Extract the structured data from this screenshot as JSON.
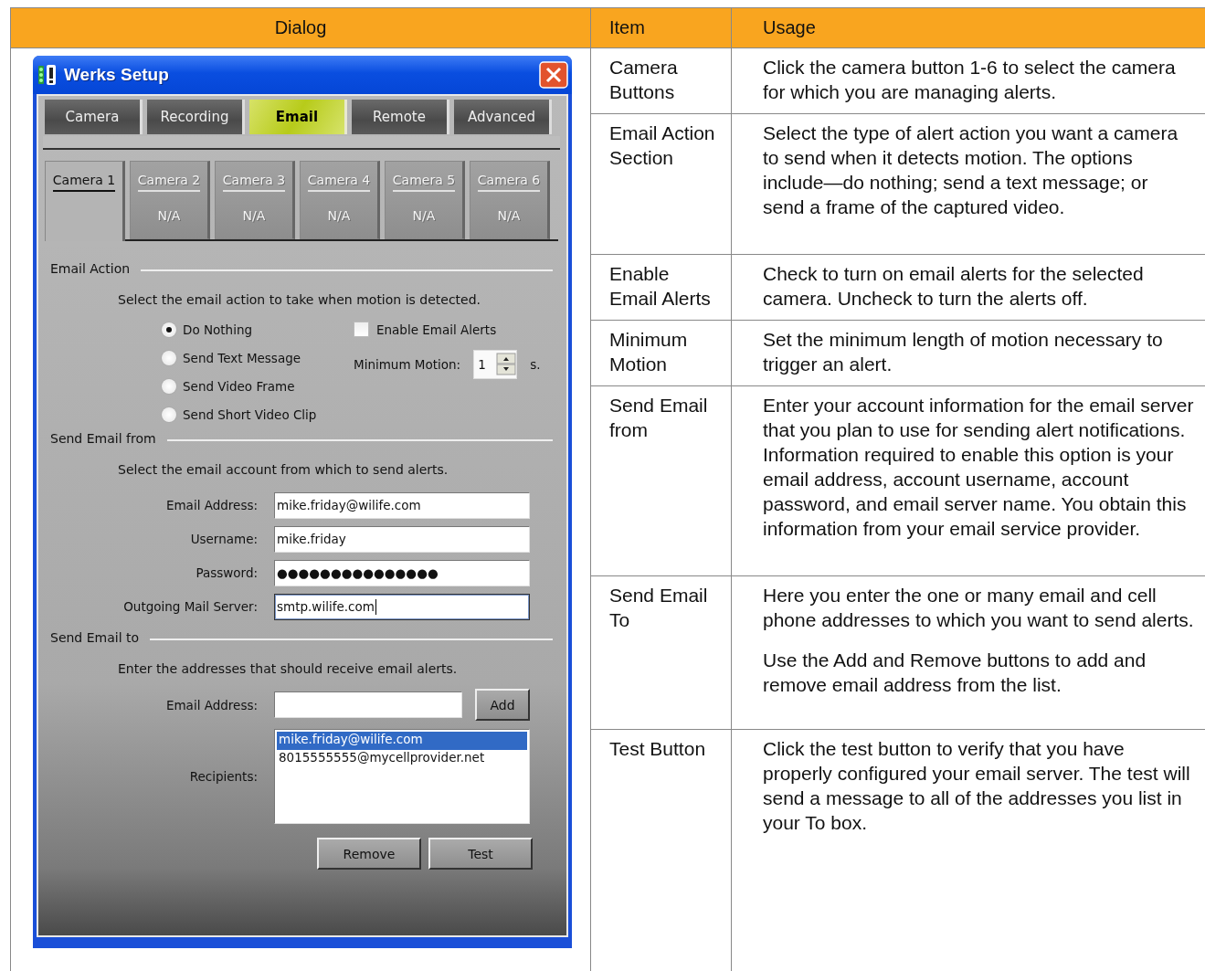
{
  "table": {
    "columns": [
      "Dialog",
      "Item",
      "Usage"
    ],
    "rows": [
      {
        "item": "Camera Buttons",
        "usage": [
          "Click the camera button 1-6 to select the camera for which you are managing alerts."
        ]
      },
      {
        "item": "Email Action Section",
        "usage": [
          "Select the type of alert action you want a camera to send when it detects motion. The options include—do nothing; send a text message; or send a frame of the captured video."
        ]
      },
      {
        "item": "Enable Email Alerts",
        "usage": [
          "Check to turn on email alerts for the selected camera. Uncheck to turn the alerts off."
        ]
      },
      {
        "item": "Minimum Motion",
        "usage": [
          "Set the minimum length of motion necessary to trigger an alert."
        ]
      },
      {
        "item": "Send Email from",
        "usage": [
          "Enter your account information for the email server that you plan to use for sending alert notifications. Information required to enable this option is your email address, account username, account password, and email server name. You obtain this information from your email service provider."
        ]
      },
      {
        "item": "Send Email To",
        "usage": [
          "Here you enter the one or many email and cell phone addresses to which you want to send alerts.",
          "Use the Add and Remove buttons to add and remove email address from the list."
        ]
      },
      {
        "item": "Test Button",
        "usage": [
          "Click the test button to verify that you have properly configured your email server. The test will send a message to all of the addresses you list in your To box."
        ]
      }
    ]
  },
  "dialog": {
    "title": "Werks Setup",
    "tabs": [
      {
        "label": "Camera",
        "selected": false
      },
      {
        "label": "Recording",
        "selected": false
      },
      {
        "label": "Email",
        "selected": true
      },
      {
        "label": "Remote",
        "selected": false
      },
      {
        "label": "Advanced",
        "selected": false
      }
    ],
    "camera_tabs": [
      {
        "label": "Camera 1",
        "selected": true,
        "disabled": false
      },
      {
        "label": "Camera 2",
        "status": "N/A",
        "selected": false,
        "disabled": true
      },
      {
        "label": "Camera 3",
        "status": "N/A",
        "selected": false,
        "disabled": true
      },
      {
        "label": "Camera 4",
        "status": "N/A",
        "selected": false,
        "disabled": true
      },
      {
        "label": "Camera 5",
        "status": "N/A",
        "selected": false,
        "disabled": true
      },
      {
        "label": "Camera 6",
        "status": "N/A",
        "selected": false,
        "disabled": true
      }
    ],
    "email_action": {
      "heading": "Email Action",
      "instruction": "Select the email action to take when motion is detected.",
      "options": [
        {
          "label": "Do Nothing",
          "selected": true
        },
        {
          "label": "Send Text Message",
          "selected": false
        },
        {
          "label": "Send Video Frame",
          "selected": false
        },
        {
          "label": "Send Short Video Clip",
          "selected": false
        }
      ],
      "enable_alerts": {
        "label": "Enable Email Alerts",
        "checked": false
      },
      "minimum_motion": {
        "label": "Minimum Motion:",
        "value": "1",
        "unit": "s."
      }
    },
    "send_from": {
      "heading": "Send Email from",
      "instruction": "Select the email account from which to send alerts.",
      "fields": [
        {
          "label": "Email Address:",
          "value": "mike.friday@wilife.com",
          "focused": false
        },
        {
          "label": "Username:",
          "value": "mike.friday",
          "focused": false
        },
        {
          "label": "Password:",
          "value": "●●●●●●●●●●●●●●●",
          "focused": false
        },
        {
          "label": "Outgoing Mail Server:",
          "value": "smtp.wilife.com",
          "focused": true
        }
      ]
    },
    "send_to": {
      "heading": "Send Email to",
      "instruction": "Enter the addresses that should receive email alerts.",
      "address_label": "Email Address:",
      "add_button": "Add",
      "recipients_label": "Recipients:",
      "recipients": [
        {
          "text": "mike.friday@wilife.com",
          "selected": true
        },
        {
          "text": "8015555555@mycellprovider.net",
          "selected": false
        }
      ],
      "buttons": [
        "Remove",
        "Test"
      ]
    }
  }
}
